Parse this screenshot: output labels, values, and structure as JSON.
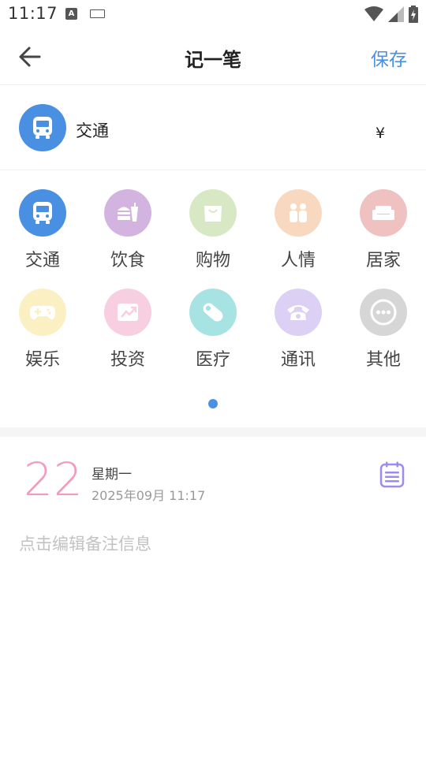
{
  "status_bar": {
    "time": "11:17",
    "a_icon": "A"
  },
  "header": {
    "title": "记一笔",
    "save_label": "保存"
  },
  "selected": {
    "name": "交通",
    "currency_symbol": "¥",
    "icon": "bus-icon",
    "color": "#4a90e2"
  },
  "categories": [
    {
      "label": "交通",
      "icon": "bus-icon",
      "color": "#4a90e2"
    },
    {
      "label": "饮食",
      "icon": "burger-drink-icon",
      "color": "#d3b4e0"
    },
    {
      "label": "购物",
      "icon": "shopping-bag-icon",
      "color": "#d8e8c4"
    },
    {
      "label": "人情",
      "icon": "people-icon",
      "color": "#f8d9c0"
    },
    {
      "label": "居家",
      "icon": "sofa-icon",
      "color": "#efc1c1"
    },
    {
      "label": "娱乐",
      "icon": "gamepad-icon",
      "color": "#faf0c4"
    },
    {
      "label": "投资",
      "icon": "trend-up-icon",
      "color": "#f8cfe0"
    },
    {
      "label": "医疗",
      "icon": "pill-icon",
      "color": "#a8e3e3"
    },
    {
      "label": "通讯",
      "icon": "telephone-icon",
      "color": "#dcd0f5"
    },
    {
      "label": "其他",
      "icon": "more-dots-icon",
      "color": "#d6d6d6"
    }
  ],
  "date": {
    "day": "22",
    "weekday": "星期一",
    "datetime": "2025年09月  11:17"
  },
  "note_placeholder": "点击编辑备注信息",
  "colors": {
    "accent": "#4a90e2",
    "day_number": "#f49ac1",
    "calendar_icon": "#9b8cf0"
  }
}
